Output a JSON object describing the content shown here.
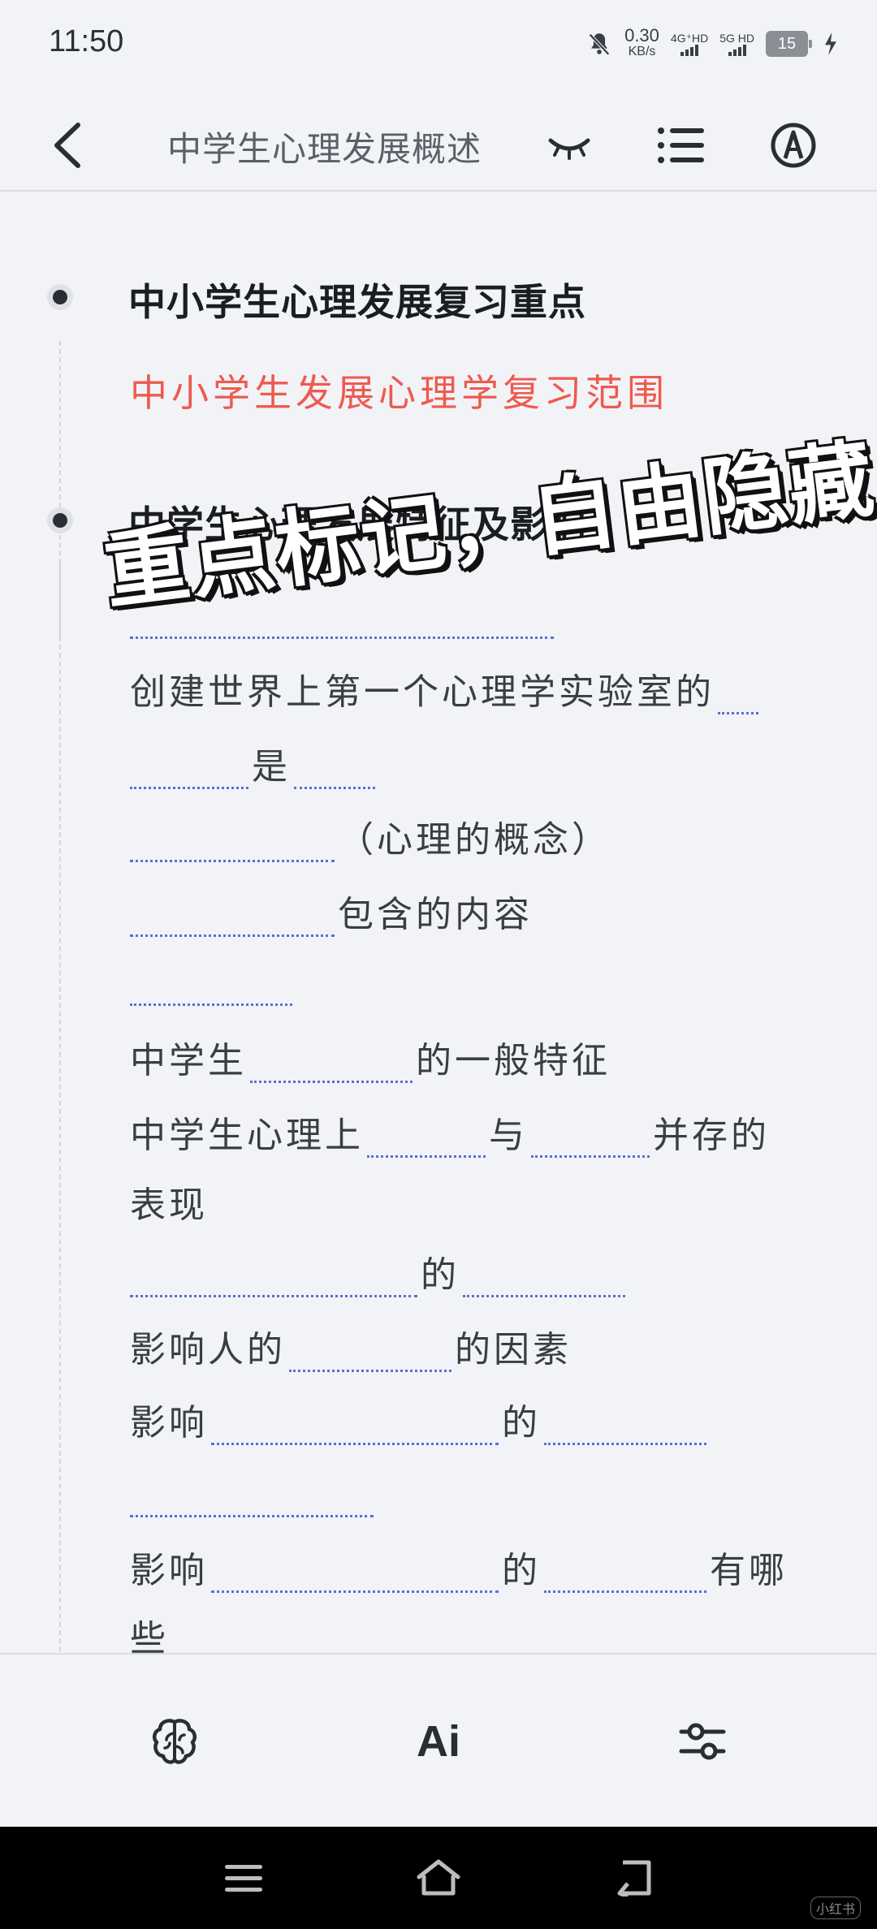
{
  "status": {
    "time": "11:50",
    "speed_value": "0.30",
    "speed_unit": "KB/s",
    "net1": "4G⁺HD",
    "net2": "5G HD",
    "battery": "15"
  },
  "header": {
    "title": "中学生心理发展概述"
  },
  "outline": {
    "section1_title": "中小学生心理发展复习重点",
    "section1_link": "中小学生发展心理学复习范围",
    "section2_title": "中学生心理发展特征及影响",
    "line1": "创建世界上第一个心理学实验室的",
    "line2_mid": "是",
    "line3_tail": "（心理的概念）",
    "line4_tail": "包含的内容",
    "line5_head": "中学生",
    "line5_tail": "的一般特征",
    "line6_head": "中学生心理上",
    "line6_mid": "与",
    "line6_tail": "并存的",
    "line6_wrap": "表现",
    "line7_mid": "的",
    "line8_head": "影响人的",
    "line8_tail": "的因素",
    "line9_head": "影响",
    "line9_mid": "的",
    "line10_head": "影响",
    "line10_mid": "的",
    "line10_tail": "有哪",
    "line10_wrap": "些"
  },
  "overlay": {
    "text": "重点标记，自由隐藏"
  },
  "toolbar": {
    "ai_label": "Ai"
  },
  "watermark": "小红书"
}
